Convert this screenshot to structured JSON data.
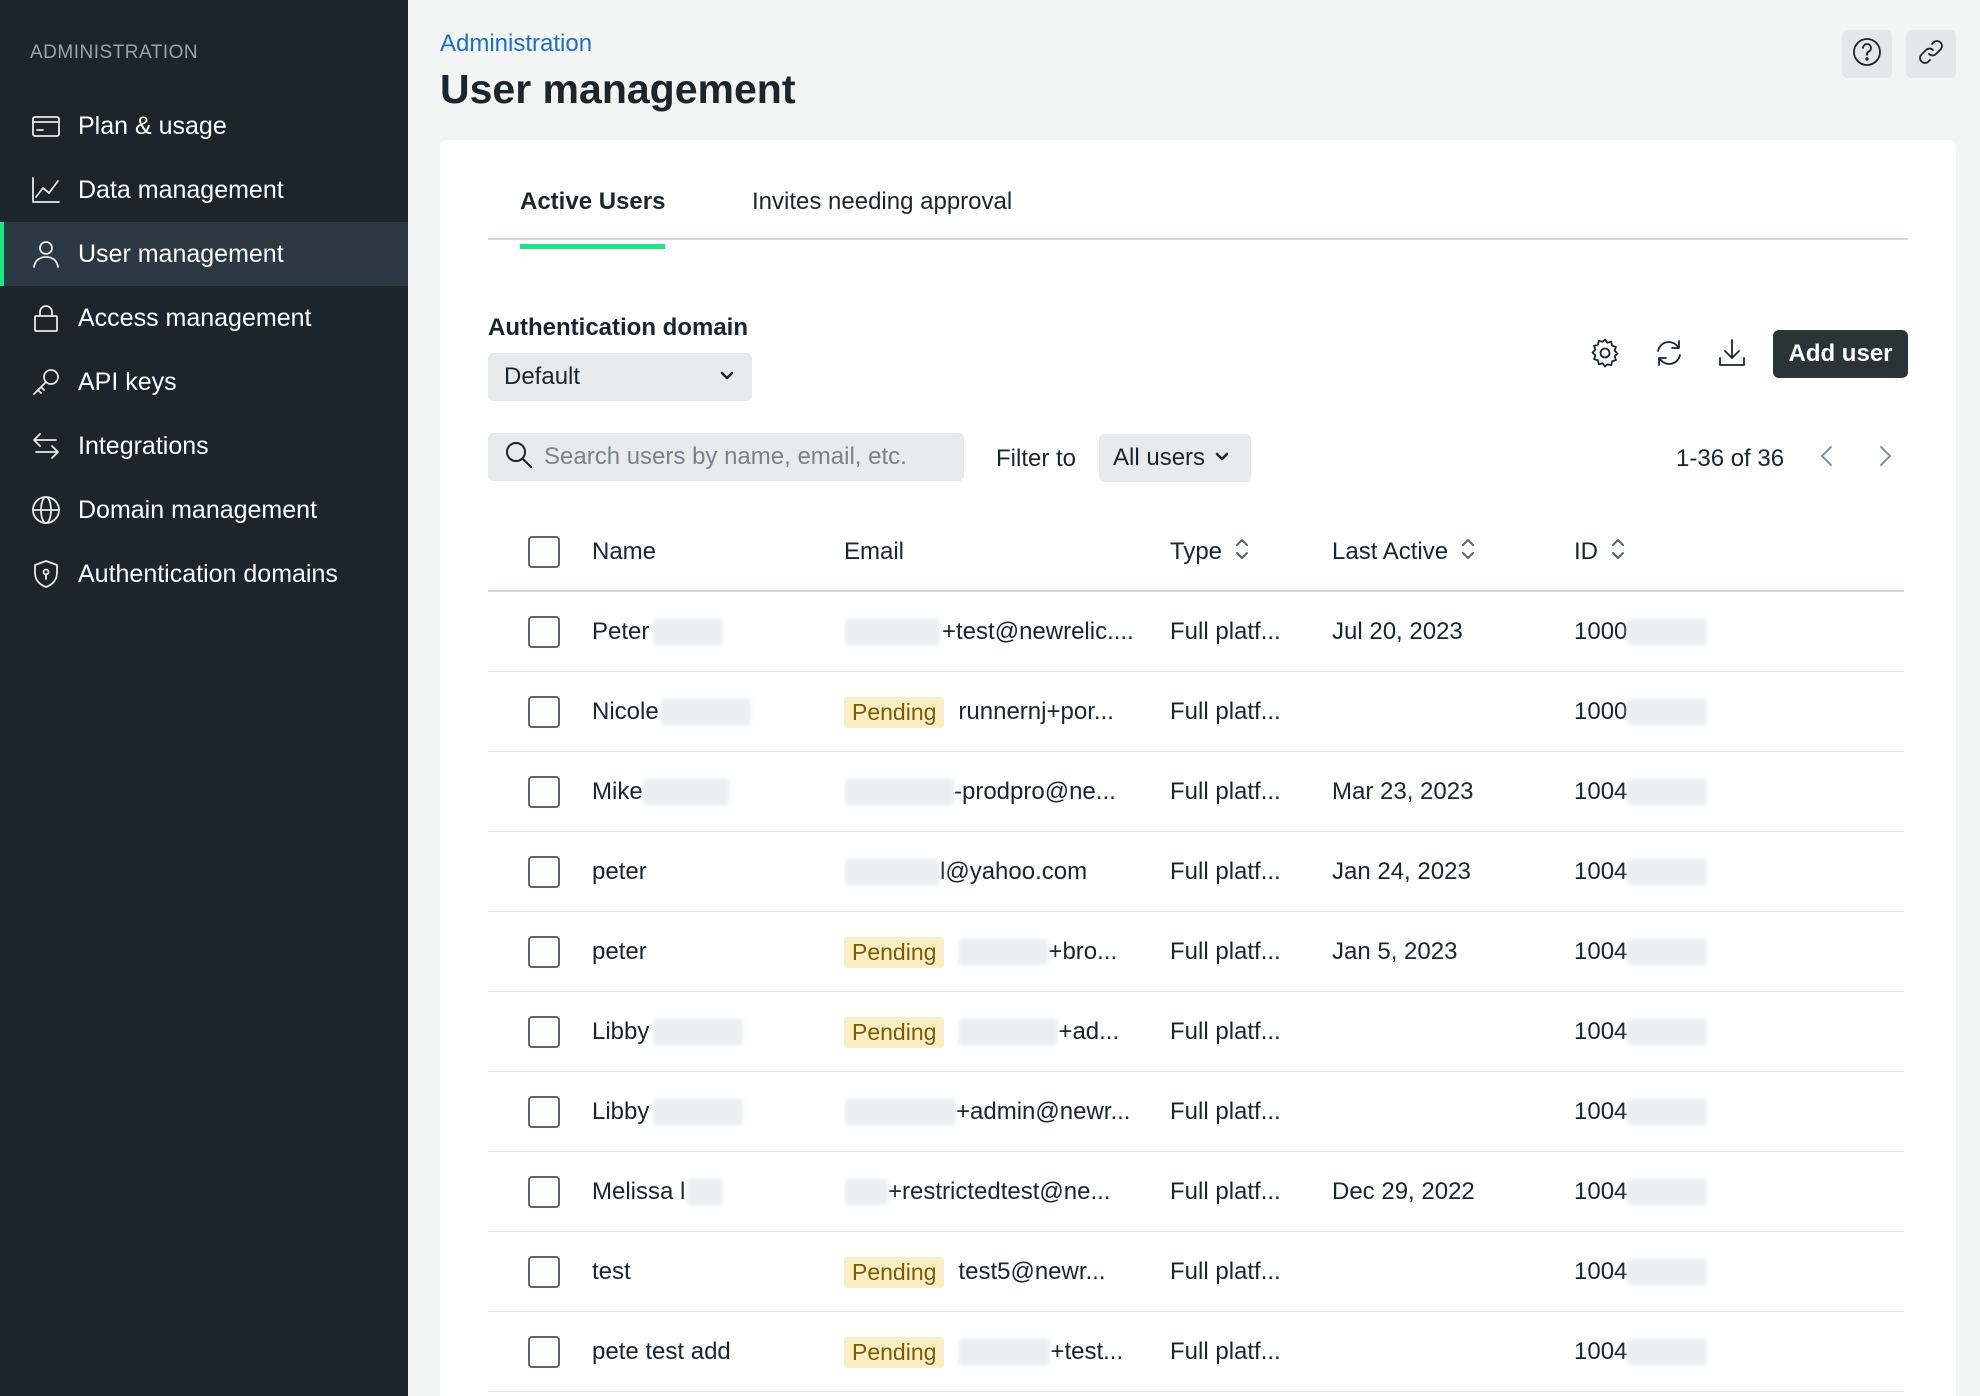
{
  "sidebar": {
    "heading": "ADMINISTRATION",
    "items": [
      {
        "label": "Plan & usage",
        "icon": "credit-card-icon"
      },
      {
        "label": "Data management",
        "icon": "line-chart-icon"
      },
      {
        "label": "User management",
        "icon": "user-icon",
        "active": true
      },
      {
        "label": "Access management",
        "icon": "lock-icon"
      },
      {
        "label": "API keys",
        "icon": "key-icon"
      },
      {
        "label": "Integrations",
        "icon": "arrows-exchange-icon"
      },
      {
        "label": "Domain management",
        "icon": "globe-icon"
      },
      {
        "label": "Authentication domains",
        "icon": "shield-icon"
      }
    ]
  },
  "header": {
    "breadcrumb": "Administration",
    "title": "User management",
    "help_icon": "help-icon",
    "link_icon": "link-icon"
  },
  "tabs": [
    {
      "label": "Active Users",
      "active": true
    },
    {
      "label": "Invites needing approval",
      "active": false
    }
  ],
  "auth_domain": {
    "label": "Authentication domain",
    "value": "Default"
  },
  "toolbar": {
    "add_user_label": "Add user",
    "icons": [
      "gear-icon",
      "refresh-icon",
      "download-icon"
    ]
  },
  "search": {
    "placeholder": "Search users by name, email, etc."
  },
  "filter": {
    "label": "Filter to",
    "value": "All users"
  },
  "pagination": {
    "text": "1-36 of 36"
  },
  "table": {
    "columns": [
      "Name",
      "Email",
      "Type",
      "Last Active",
      "ID"
    ],
    "rows": [
      {
        "name": "Peter",
        "pending": "",
        "email": "+test@newrelic....",
        "type": "Full platf...",
        "last_active": "Jul 20, 2023",
        "id": "1000"
      },
      {
        "name": "Nicole",
        "pending": "Pending",
        "email": "runnernj+por...",
        "type": "Full platf...",
        "last_active": "",
        "id": "1000"
      },
      {
        "name": "Mike",
        "pending": "",
        "email": "-prodpro@ne...",
        "type": "Full platf...",
        "last_active": "Mar 23, 2023",
        "id": "1004"
      },
      {
        "name": "peter",
        "pending": "",
        "email": "l@yahoo.com",
        "type": "Full platf...",
        "last_active": "Jan 24, 2023",
        "id": "1004"
      },
      {
        "name": "peter",
        "pending": "Pending",
        "email": "+bro...",
        "type": "Full platf...",
        "last_active": "Jan 5, 2023",
        "id": "1004"
      },
      {
        "name": "Libby",
        "pending": "Pending",
        "email": "+ad...",
        "type": "Full platf...",
        "last_active": "",
        "id": "1004"
      },
      {
        "name": "Libby",
        "pending": "",
        "email": "+admin@newr...",
        "type": "Full platf...",
        "last_active": "",
        "id": "1004"
      },
      {
        "name": "Melissa l",
        "pending": "",
        "email": "+restrictedtest@ne...",
        "type": "Full platf...",
        "last_active": "Dec 29, 2022",
        "id": "1004"
      },
      {
        "name": "test",
        "pending": "Pending",
        "email": "test5@newr...",
        "type": "Full platf...",
        "last_active": "",
        "id": "1004"
      },
      {
        "name": "pete test add",
        "pending": "Pending",
        "email": "+test...",
        "type": "Full platf...",
        "last_active": "",
        "id": "1004"
      }
    ]
  }
}
